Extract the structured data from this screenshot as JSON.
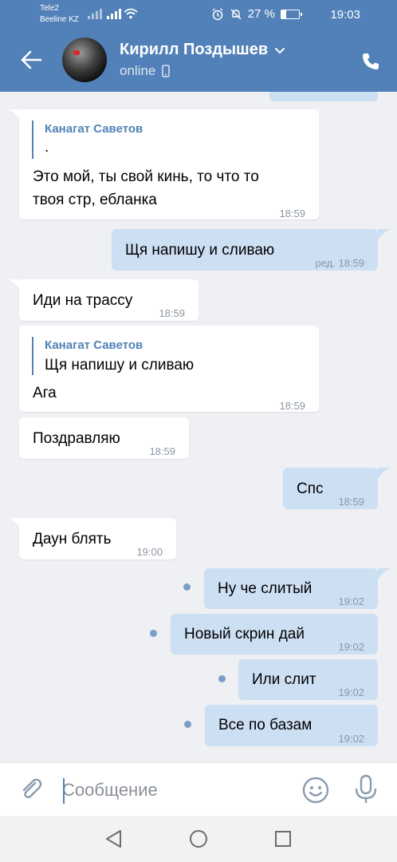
{
  "status_bar": {
    "carrier_1": "Tele2",
    "carrier_2": "Beeline KZ",
    "battery_percent": "27 %",
    "battery_level": 0.27,
    "time": "19:03"
  },
  "header": {
    "contact_name": "Кирилл Поздышев",
    "contact_status": "online",
    "icons": [
      "back-arrow-icon",
      "chevron-down-icon",
      "phone-device-icon",
      "phone-call-icon"
    ]
  },
  "messages": [
    {
      "direction": "in",
      "quote_author": "Канагат Саветов",
      "quote_text": ".",
      "text_line_1": "Это мой, ты свой кинь, то что то",
      "text_line_2": "твоя стр, ебланка",
      "time": "18:59"
    },
    {
      "direction": "out",
      "text": "Щя напишу и сливаю",
      "time": "ред. 18:59"
    },
    {
      "direction": "in",
      "text": "Иди на трассу",
      "time": "18:59"
    },
    {
      "direction": "in",
      "quote_author": "Канагат Саветов",
      "quote_text": "Щя напишу и сливаю",
      "text": "Ага",
      "time": "18:59"
    },
    {
      "direction": "in",
      "text": "Поздравляю",
      "time": "18:59"
    },
    {
      "direction": "out",
      "text": "Спс",
      "time": "18:59"
    },
    {
      "direction": "in",
      "text": "Даун блять",
      "time": "19:00"
    },
    {
      "direction": "out",
      "text": "Ну че слитый",
      "time": "19:02",
      "unread": true
    },
    {
      "direction": "out",
      "text": "Новый скрин дай",
      "time": "19:02",
      "unread": true
    },
    {
      "direction": "out",
      "text": "Или слит",
      "time": "19:02",
      "unread": true
    },
    {
      "direction": "out",
      "text": "Все по базам",
      "time": "19:02",
      "unread": true
    }
  ],
  "composer": {
    "placeholder": "Сообщение",
    "value": "",
    "icons": [
      "paperclip-icon",
      "emoji-icon",
      "microphone-icon"
    ]
  },
  "nav_bar": {
    "icons": [
      "nav-back-icon",
      "nav-home-icon",
      "nav-recents-icon"
    ]
  },
  "colors": {
    "header": "#5181b8",
    "chat_background": "#eef0f3",
    "incoming_bubble": "#ffffff",
    "outgoing_bubble": "#cddff3",
    "accent": "#5181b8",
    "unread_dot": "#7b9ec7"
  }
}
